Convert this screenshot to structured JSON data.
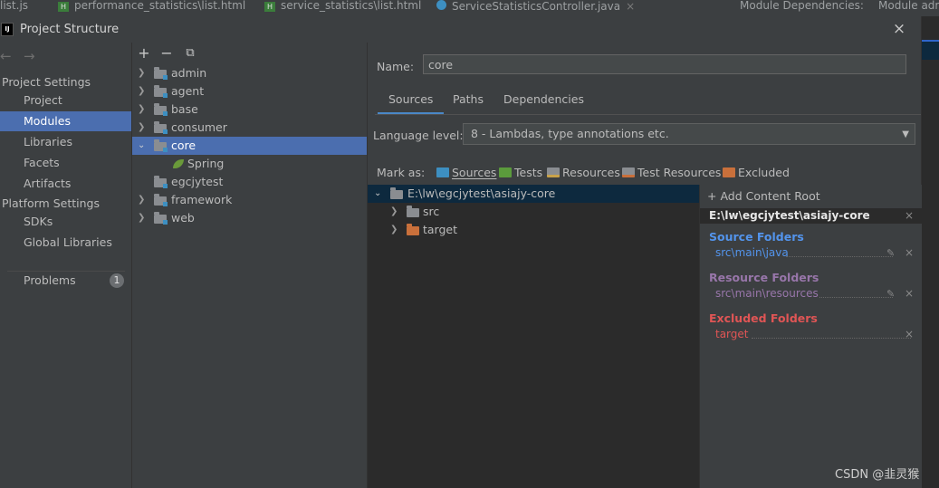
{
  "background_tabs": [
    {
      "label": "list.js",
      "badge": "js"
    },
    {
      "label": "performance_statistics\\list.html",
      "badge": "H"
    },
    {
      "label": "service_statistics\\list.html",
      "badge": "H"
    },
    {
      "label": "ServiceStatisticsController.java",
      "badge": "C"
    },
    {
      "label": "Module Dependencies:",
      "badge": ""
    },
    {
      "label": "Module adm",
      "badge": ""
    }
  ],
  "close_glyph": "×",
  "dialog": {
    "logo": "IJ",
    "title": "Project Structure",
    "close_glyph": "×"
  },
  "nav": {
    "back_glyph": "←",
    "forward_glyph": "→",
    "project_settings_header": "Project Settings",
    "project_settings_items": [
      "Project",
      "Modules",
      "Libraries",
      "Facets",
      "Artifacts"
    ],
    "platform_settings_header": "Platform Settings",
    "platform_settings_items": [
      "SDKs",
      "Global Libraries"
    ],
    "problems_label": "Problems",
    "problems_count": "1",
    "selected": "Modules"
  },
  "module_toolbar": {
    "add_glyph": "+",
    "remove_glyph": "−",
    "copy_glyph": "⧉"
  },
  "modules": [
    {
      "label": "admin",
      "expanded": false
    },
    {
      "label": "agent",
      "expanded": false
    },
    {
      "label": "base",
      "expanded": false
    },
    {
      "label": "consumer",
      "expanded": false
    },
    {
      "label": "core",
      "expanded": true,
      "selected": true
    },
    {
      "label": "Spring",
      "child": true
    },
    {
      "label": "egcjytest",
      "expanded": false,
      "leafless": true
    },
    {
      "label": "framework",
      "expanded": false
    },
    {
      "label": "web",
      "expanded": false
    }
  ],
  "right": {
    "name_label": "Name:",
    "name_value": "core",
    "tabs": [
      "Sources",
      "Paths",
      "Dependencies"
    ],
    "active_tab": "Sources",
    "language_label": "Language level:",
    "language_value": "8 - Lambdas, type annotations etc.",
    "mark_as_label": "Mark as:",
    "mark_as": [
      {
        "label": "Sources",
        "color": "#3d8fc1",
        "underline": "S"
      },
      {
        "label": "Tests",
        "color": "#5b9b3c",
        "underline": "T"
      },
      {
        "label": "Resources",
        "color": "#8a8d91",
        "underline": ""
      },
      {
        "label": "Test Resources",
        "color": "#8a8d91",
        "underline": ""
      },
      {
        "label": "Excluded",
        "color": "#c9703b",
        "underline": "E"
      }
    ],
    "content_root": "E:\\lw\\egcjytest\\asiajy-core",
    "content_children": [
      {
        "label": "src",
        "color": "#8a8d91"
      },
      {
        "label": "target",
        "color": "#c9703b"
      }
    ],
    "add_content_root": "+ Add Content Root",
    "summary_root": "E:\\lw\\egcjytest\\asiajy-core",
    "groups": [
      {
        "title": "Source Folders",
        "title_color": "#5394ec",
        "path": "src\\main\\java",
        "path_color": "#5394ec",
        "editable": true
      },
      {
        "title": "Resource Folders",
        "title_color": "#9876aa",
        "path": "src\\main\\resources",
        "path_color": "#9876aa",
        "editable": true
      },
      {
        "title": "Excluded Folders",
        "title_color": "#e05555",
        "path": "target",
        "path_color": "#e05555",
        "editable": false
      }
    ]
  },
  "watermark": "CSDN @韭灵猴"
}
